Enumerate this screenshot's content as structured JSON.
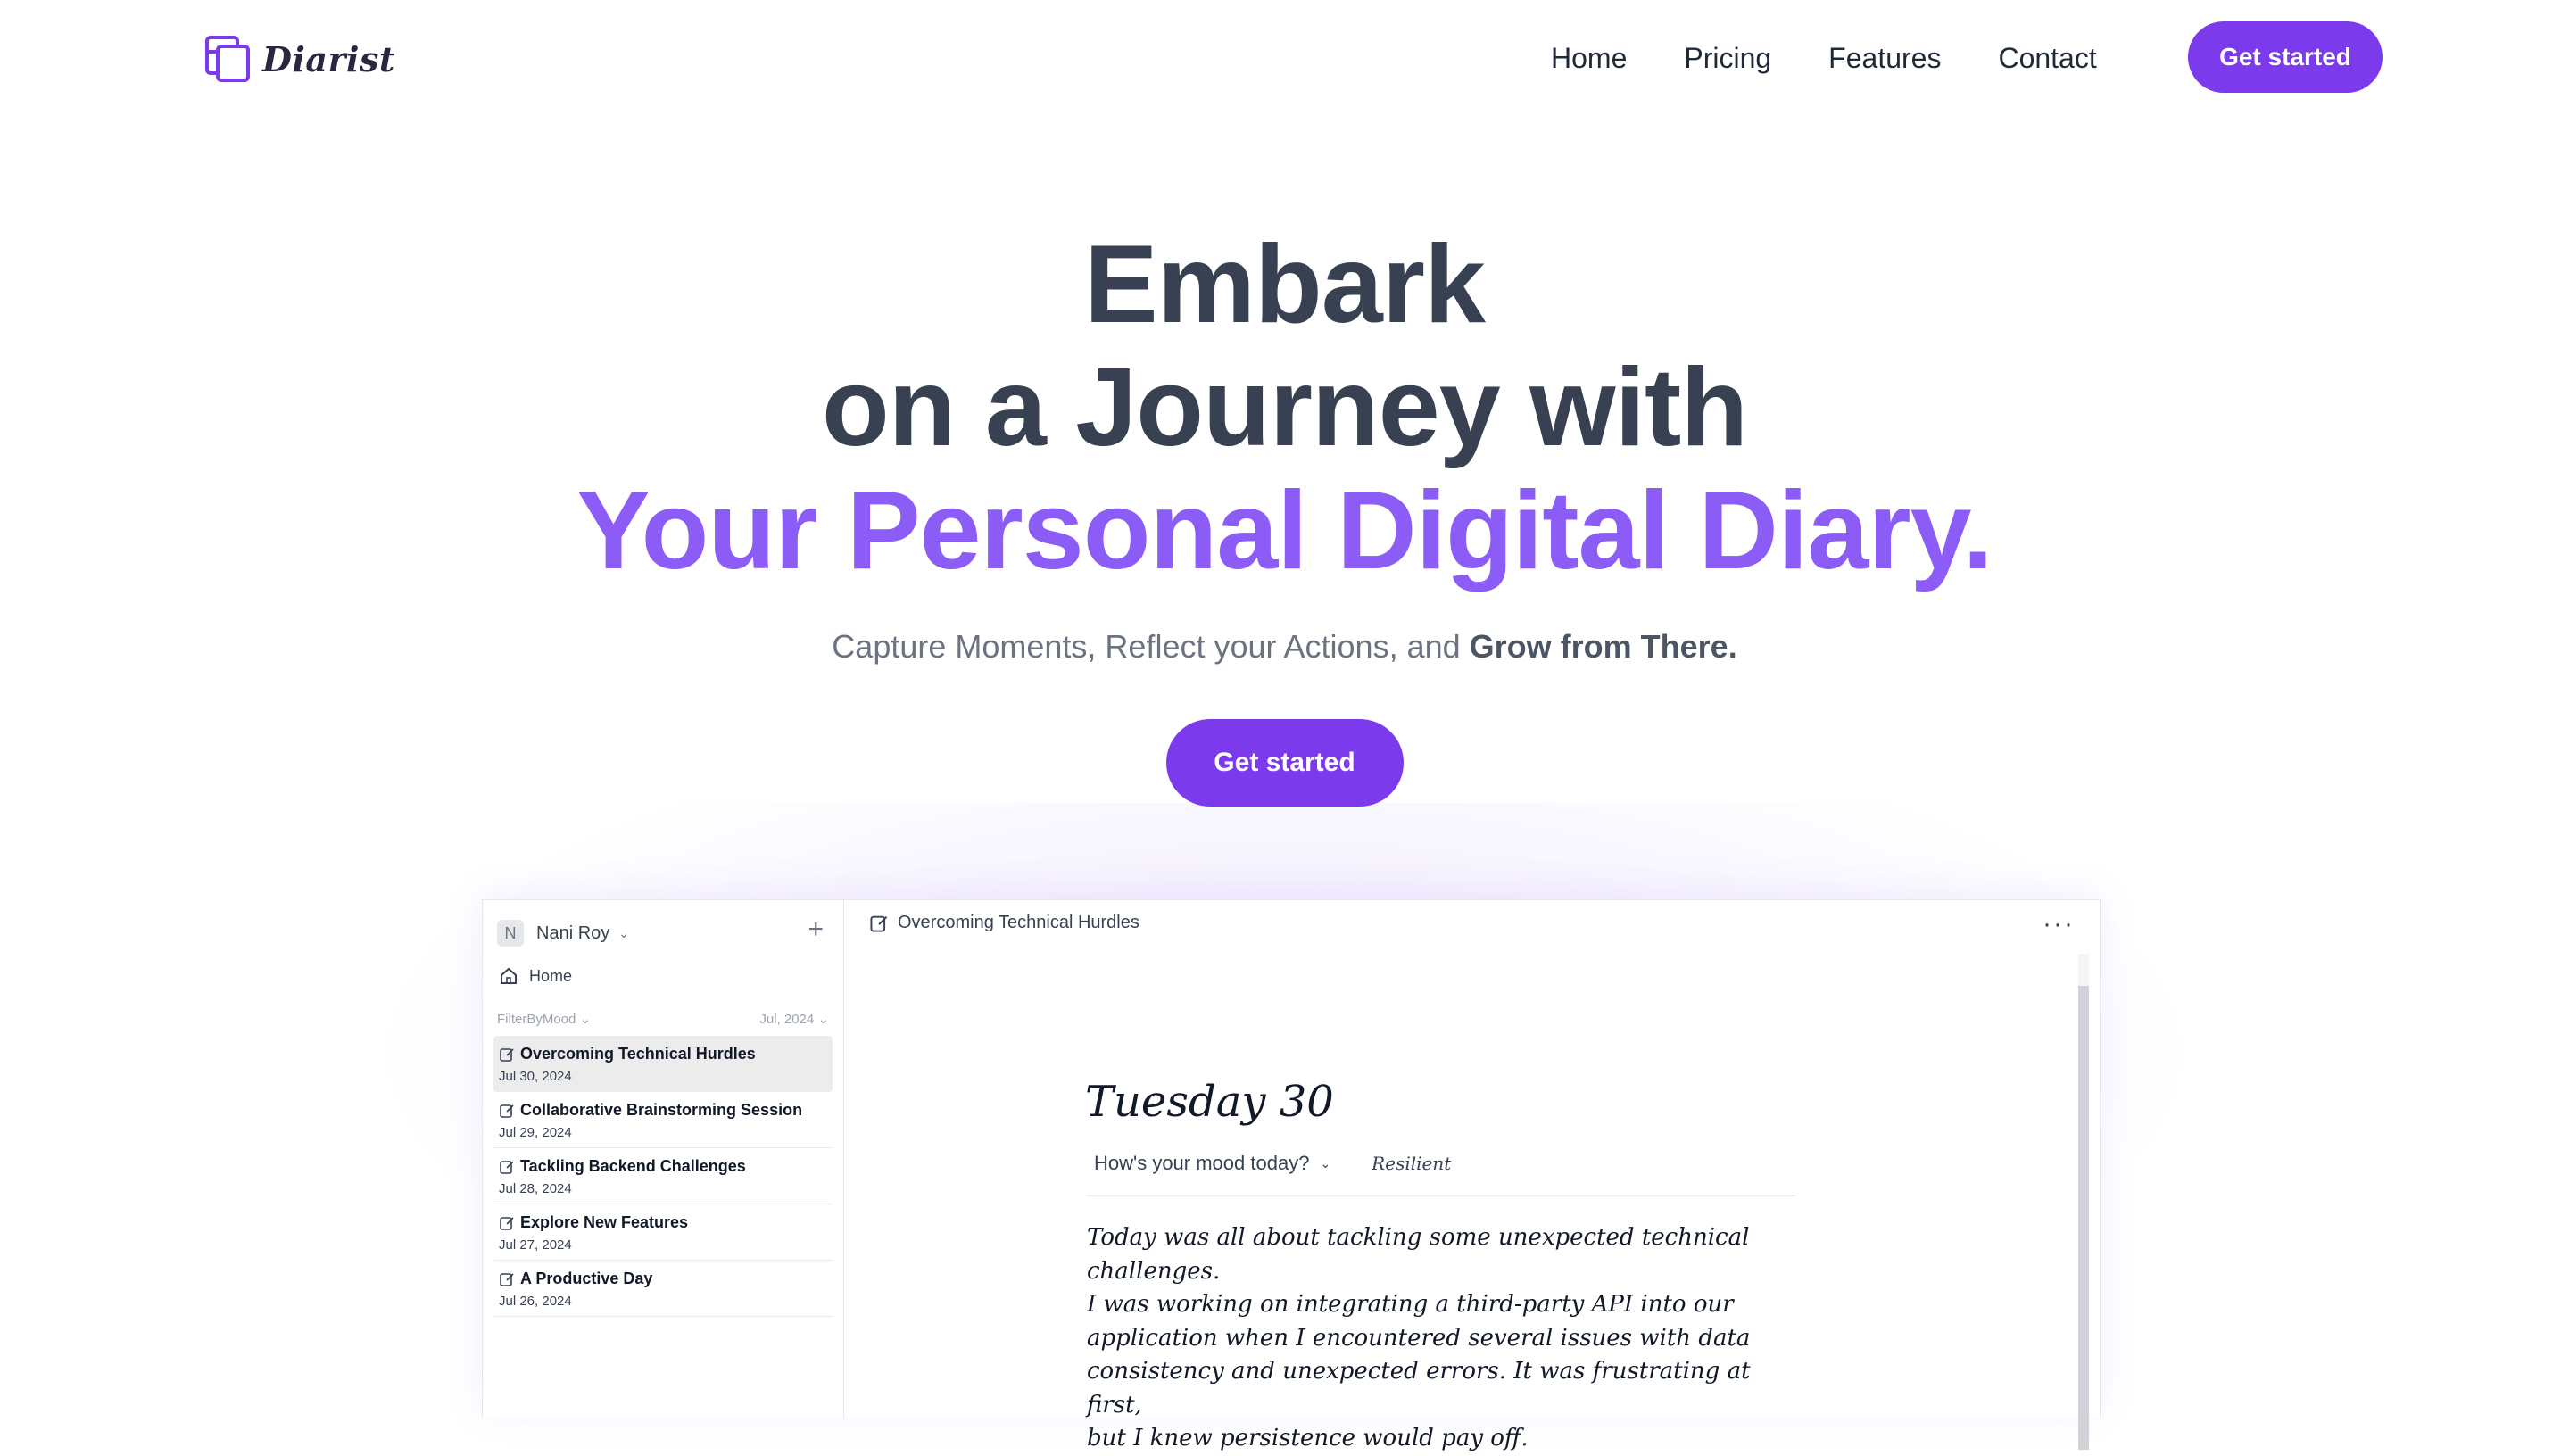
{
  "brand": {
    "name": "Diarist",
    "color": "#7c3aed",
    "accent": "#8b5cf6"
  },
  "nav": {
    "links": [
      "Home",
      "Pricing",
      "Features",
      "Contact"
    ],
    "cta": "Get started"
  },
  "hero": {
    "line1": "Embark",
    "line2": "on a Journey with",
    "line3": "Your Personal Digital Diary.",
    "subtitle_plain": "Capture Moments, Reflect your Actions, and",
    "subtitle_bold": "Grow from There.",
    "cta": "Get started"
  },
  "app": {
    "workspace": {
      "initial": "N",
      "name": "Nani Roy"
    },
    "home_label": "Home",
    "filter_label": "FilterByMood",
    "month_label": "Jul, 2024",
    "entries": [
      {
        "title": "Overcoming Technical Hurdles",
        "date": "Jul 30, 2024",
        "active": true
      },
      {
        "title": "Collaborative Brainstorming Session",
        "date": "Jul 29, 2024"
      },
      {
        "title": "Tackling Backend Challenges",
        "date": "Jul 28, 2024"
      },
      {
        "title": "Explore New Features",
        "date": "Jul 27, 2024"
      },
      {
        "title": "A Productive Day",
        "date": "Jul 26, 2024"
      }
    ],
    "doc_title": "Overcoming Technical Hurdles",
    "more_icon": "more-horizontal-icon",
    "day_heading": "Tuesday 30",
    "mood_question": "How's your mood today?",
    "mood_value": "Resilient",
    "body_lines": [
      "Today was all about tackling some unexpected technical challenges.",
      "I was working on integrating a third-party API into our",
      "application when I encountered several issues with data",
      "consistency and unexpected errors. It was frustrating at first,",
      "but I knew persistence would pay off."
    ]
  }
}
